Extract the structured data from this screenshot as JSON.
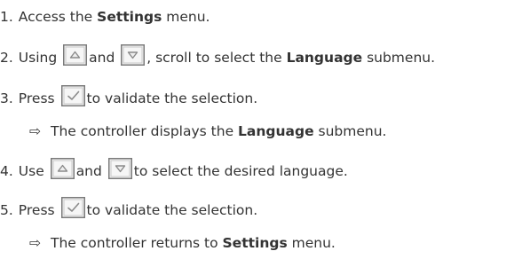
{
  "steps": [
    {
      "number": "1.",
      "parts": [
        "Access the ",
        "Settings",
        " menu."
      ]
    },
    {
      "number": "2.",
      "parts": [
        "Using ",
        "and ",
        ", scroll to select the ",
        "Language",
        " submenu."
      ]
    },
    {
      "number": "3.",
      "parts": [
        "Press ",
        "to validate the selection."
      ],
      "result": {
        "arrow": "⇨",
        "parts": [
          "The controller displays the ",
          "Language",
          " submenu."
        ]
      }
    },
    {
      "number": "4.",
      "parts": [
        "Use ",
        "and ",
        "to select the desired language."
      ]
    },
    {
      "number": "5.",
      "parts": [
        "Press ",
        "to validate the selection."
      ],
      "result": {
        "arrow": "⇨",
        "parts": [
          "The controller returns to ",
          "Settings",
          " menu."
        ]
      }
    }
  ],
  "icons": {
    "up": "chevron-up-button-icon",
    "down": "chevron-down-button-icon",
    "ok": "checkmark-button-icon"
  },
  "colors": {
    "text": "#333333",
    "button_border": "#7a7a7a",
    "button_fill": "#f6f6f6",
    "glyph": "#8a8a8a"
  }
}
